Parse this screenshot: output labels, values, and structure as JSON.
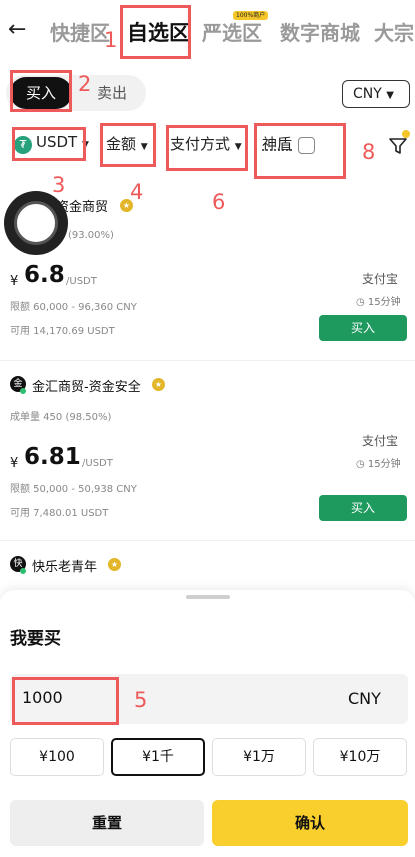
{
  "header": {
    "tabs": [
      "快捷区",
      "自选区",
      "严选区",
      "数字商城",
      "大宗"
    ],
    "badge": "100%商户"
  },
  "trade": {
    "buy": "买入",
    "sell": "卖出",
    "currency": "CNY"
  },
  "filters": {
    "coin": "USDT",
    "amount": "金额",
    "payment": "支付方式",
    "shield": "神盾"
  },
  "merchants": [
    {
      "name": "资金商贸",
      "completion": "(93.00%)",
      "price": "6.8",
      "unit": "/USDT",
      "limit": "限额 60,000 - 96,360 CNY",
      "available": "可用 14,170.69 USDT",
      "payment": "支付宝",
      "time": "15分钟",
      "action": "买入"
    },
    {
      "avatar": "金",
      "name": "金汇商贸-资金安全",
      "orders": "成单量 450 (98.50%)",
      "price": "6.81",
      "unit": "/USDT",
      "limit": "限额 50,000 - 50,938 CNY",
      "available": "可用 7,480.01 USDT",
      "payment": "支付宝",
      "time": "15分钟",
      "action": "买入"
    },
    {
      "avatar": "快",
      "name": "快乐老青年"
    }
  ],
  "sheet": {
    "title": "我要买",
    "amount": "1000",
    "currency": "CNY",
    "quick": [
      "¥100",
      "¥1千",
      "¥1万",
      "¥10万"
    ],
    "reset": "重置",
    "confirm": "确认"
  },
  "annotations": [
    "1",
    "2",
    "3",
    "4",
    "5",
    "6",
    "8"
  ],
  "colors": {
    "accent": "#f8cf2d",
    "buy_green": "#1f9a5f",
    "annotation": "#ee5a5a"
  }
}
